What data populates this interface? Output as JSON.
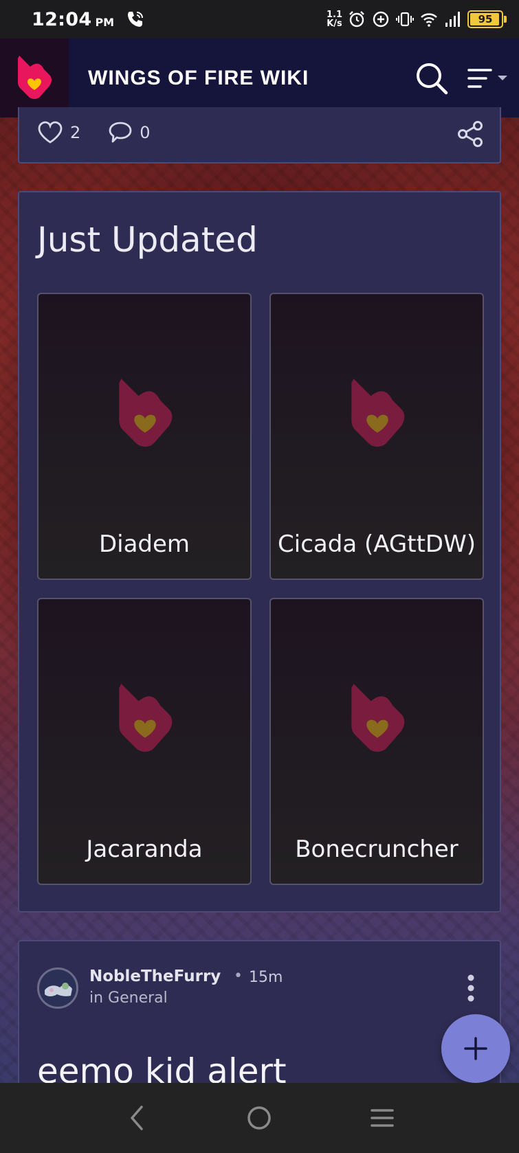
{
  "status_bar": {
    "time": "12:04",
    "ampm": "PM",
    "speed_top": "1.1",
    "speed_bottom": "K/s",
    "battery": "95",
    "battery_level": 0.95
  },
  "header": {
    "title": "WINGS OF FIRE WIKI",
    "icons": [
      "fandom-logo-icon",
      "search-icon",
      "menu-icon",
      "chevron-down-icon"
    ]
  },
  "prev_post": {
    "likes": "2",
    "comments": "0"
  },
  "just_updated": {
    "title": "Just Updated",
    "cards": [
      {
        "label": "Diadem"
      },
      {
        "label": "Cicada (AGttDW)"
      },
      {
        "label": "Jacaranda"
      },
      {
        "label": "Bonecruncher"
      }
    ]
  },
  "post": {
    "author": "NobleTheFurry",
    "separator": "•",
    "time": "15m",
    "category": "in General",
    "title": "eemo kid alert"
  },
  "colors": {
    "header_bg": "#15143a",
    "panel_bg": "#2e2c52",
    "brand_pink": "#e8175d",
    "brand_yellow": "#ffc500",
    "fab": "#7b80d6"
  }
}
